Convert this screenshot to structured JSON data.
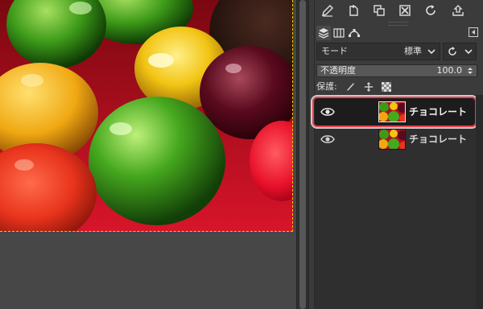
{
  "colors": {
    "selection_ring": "#e8414e",
    "layer_boundary": "#f0c800",
    "selected_row": "#1c1c1c"
  },
  "toolbar": {
    "icons": [
      "edit-icon",
      "new-layer-icon",
      "duplicate-icon",
      "delete-icon",
      "refresh-icon",
      "export-icon"
    ]
  },
  "tabs": {
    "items": [
      "layers-tab-icon",
      "channels-tab-icon",
      "paths-tab-icon"
    ],
    "menu": "tab-menu-icon"
  },
  "mode": {
    "label": "モード",
    "value": "標準"
  },
  "opacity": {
    "label": "不透明度",
    "value": "100.0",
    "percent": 100
  },
  "lock": {
    "label": "保護:",
    "icons": [
      "brush-lock-icon",
      "move-lock-icon",
      "alpha-lock-icon"
    ]
  },
  "layers": [
    {
      "name": "チョコレート",
      "visible": true,
      "selected": true
    },
    {
      "name": "チョコレート",
      "visible": true,
      "selected": false
    }
  ]
}
